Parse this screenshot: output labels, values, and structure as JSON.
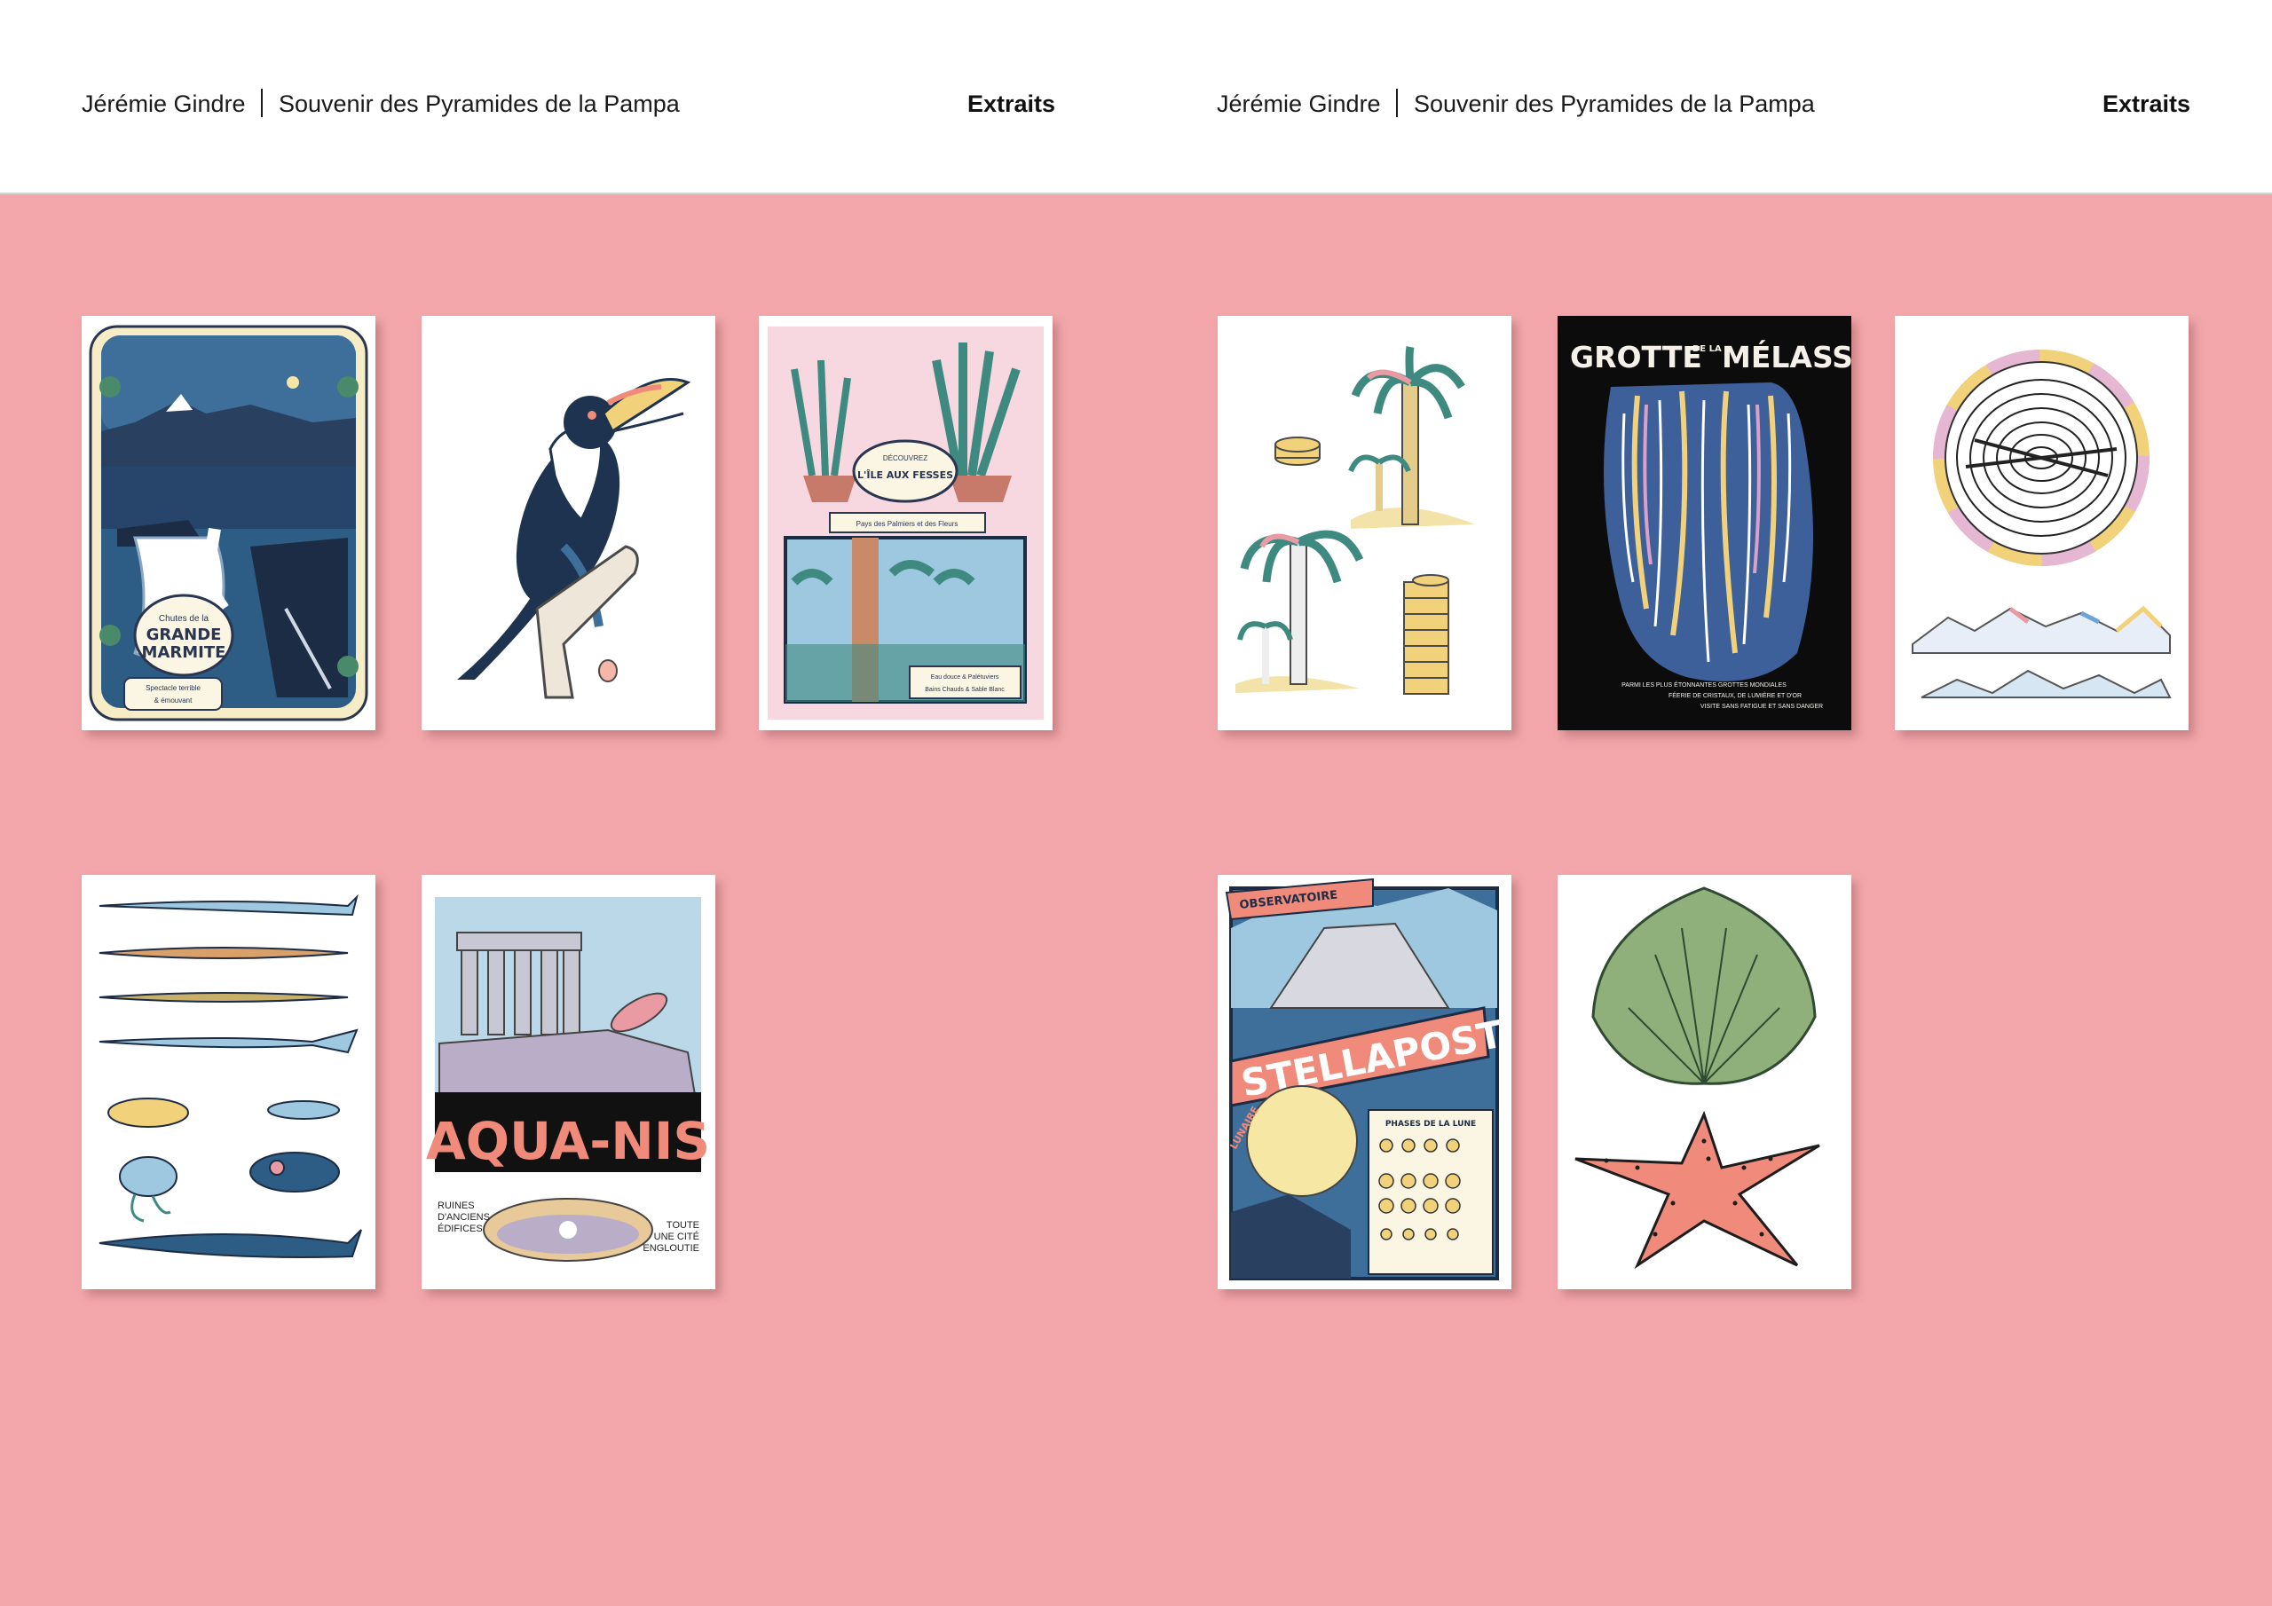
{
  "header": {
    "left": {
      "author": "Jérémie Gindre",
      "book": "Souvenir des Pyramides de la Pampa",
      "section": "Extraits"
    },
    "right": {
      "author": "Jérémie Gindre",
      "book": "Souvenir des Pyramides de la Pampa",
      "section": "Extraits"
    }
  },
  "colors": {
    "background": "#f3a7ab",
    "header": "#ffffff",
    "text": "#1a1a1a"
  },
  "cards": {
    "marmite": {
      "line1": "Chutes de la",
      "line2": "GRANDE",
      "line3": "MARMITE",
      "caption1": "Spectacle terrible",
      "caption2": "& émouvant"
    },
    "fesses": {
      "line1": "DÉCOUVREZ",
      "line2": "L'ÎLE AUX FESSES",
      "banner": "Pays des Palmiers et des Fleurs",
      "caption1": "Eau douce & Palétuviers",
      "caption2": "Bains Chauds & Sable Blanc"
    },
    "melasse": {
      "title1": "GROTTE",
      "title_small": "DE LA",
      "title2": "MÉLASSE",
      "caption1": "PARMI LES PLUS ÉTONNANTES GROTTES MONDIALES",
      "caption2": "FÉERIE DE CRISTAUX, DE LUMIÈRE ET D'OR",
      "caption3": "VISITE SANS FATIGUE ET SANS DANGER"
    },
    "aquanis": {
      "title": "AQUA-NIS",
      "left1": "RUINES",
      "left2": "D'ANCIENS",
      "left3": "ÉDIFICES",
      "right1": "TOUTE",
      "right2": "UNE CITÉ",
      "right3": "ENGLOUTIE"
    },
    "stellaposti": {
      "top": "OBSERVATOIRE",
      "title": "STELLAPOSTI",
      "side": "LUNAIRE",
      "phases": "PHASES DE LA LUNE"
    }
  }
}
